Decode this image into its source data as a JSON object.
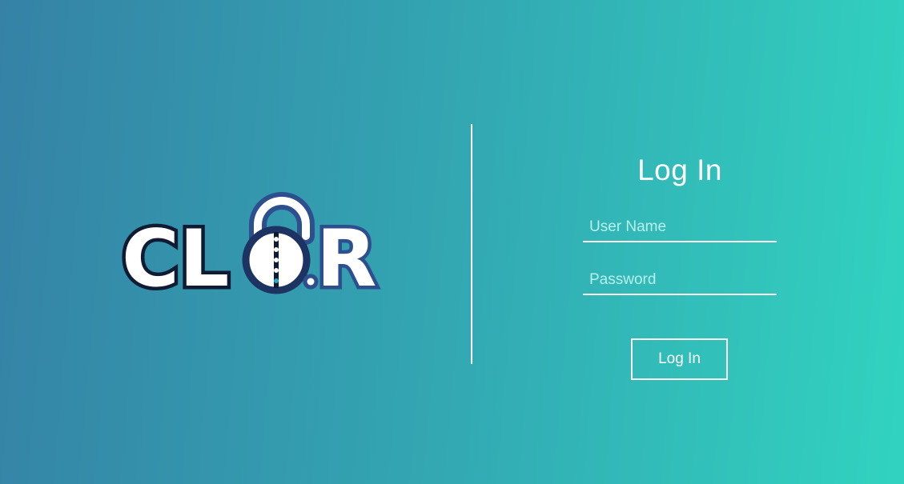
{
  "brand": {
    "logo_text": "CLOR",
    "colors": {
      "logo_outline_dark": "#0f1b33",
      "logo_outline_blue": "#2e4f8e",
      "logo_fill": "#ffffff",
      "logo_accent": "#2aa8c9"
    }
  },
  "login": {
    "title": "Log In",
    "username_placeholder": "User Name",
    "password_placeholder": "Password",
    "button_label": "Log In"
  },
  "theme": {
    "gradient_start": "#3582a6",
    "gradient_end": "#31d3c0",
    "text_color": "#ffffff"
  }
}
